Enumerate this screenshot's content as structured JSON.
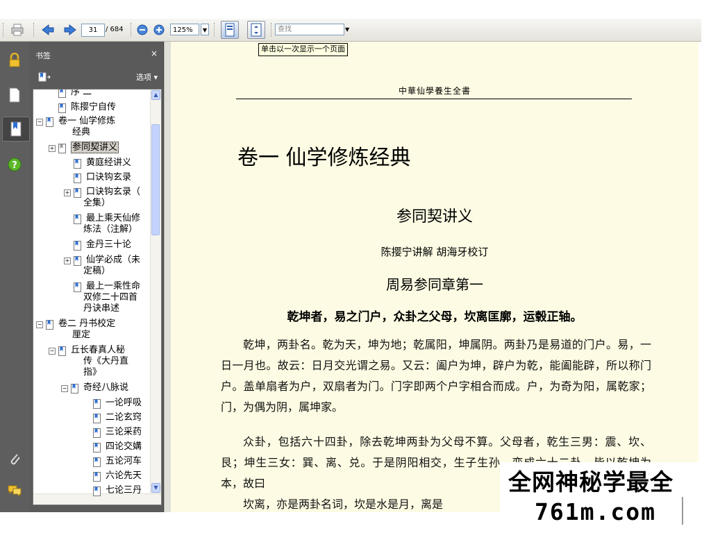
{
  "toolbar": {
    "current_page": "31",
    "total_pages": "/ 684",
    "zoom": "125%",
    "find_placeholder": "查找",
    "tooltip": "单击以一次显示一个页面"
  },
  "bookmarks": {
    "panel_title": "书签",
    "close": "×",
    "options": "选项 ▾",
    "items": [
      {
        "label": "序 二"
      },
      {
        "label": "陈撄宁自传"
      },
      {
        "label": "卷一 仙学修炼"
      },
      {
        "label": "经典"
      },
      {
        "label": "参同契讲义"
      },
      {
        "label": "黄庭经讲义"
      },
      {
        "label": "口诀钩玄录"
      },
      {
        "label": "口诀钩玄录（"
      },
      {
        "label": "全集）"
      },
      {
        "label": "最上乘天仙修"
      },
      {
        "label": "炼法（注解）"
      },
      {
        "label": "金丹三十论"
      },
      {
        "label": "仙学必成（未"
      },
      {
        "label": "定稿）"
      },
      {
        "label": "最上一乘性命"
      },
      {
        "label": "双修二十四首"
      },
      {
        "label": "丹诀串述"
      },
      {
        "label": "卷二 丹书校定"
      },
      {
        "label": "厘定"
      },
      {
        "label": "丘长春真人秘"
      },
      {
        "label": "传《大丹直"
      },
      {
        "label": "指》"
      },
      {
        "label": "奇经八脉说"
      },
      {
        "label": "一论呼吸"
      },
      {
        "label": "二论玄窍"
      },
      {
        "label": "三论采药"
      },
      {
        "label": "四论交媾"
      },
      {
        "label": "五论河车"
      },
      {
        "label": "六论先天"
      },
      {
        "label": "七论三丹"
      }
    ]
  },
  "document": {
    "running_header": "中華仙學養生全書",
    "volume_title": "卷一  仙学修炼经典",
    "chapter_title": "参同契讲义",
    "author_line": "陈撄宁讲解  胡海牙校订",
    "section_title": "周易参同章第一",
    "key_line": "乾坤者，易之门户，众卦之父母，坎离匡廓，运毂正轴。",
    "paragraphs": [
      "乾坤，两卦名。乾为天，坤为地；乾属阳，坤属阴。两卦乃是易道的门户。易，一日一月也。故云：日月交光谓之易。又云：阖户为坤，辟户为乾，能阖能辟，所以称门户。盖单扇者为户，双扇者为门。门字即两个户字相合而成。户，为奇为阳，属乾家；门，为偶为阴，属坤家。",
      "众卦，包括六十四卦，除去乾坤两卦为父母不算。父母者，乾生三男：震、坎、艮；坤生三女：巽、离、兑。于是阴阳相交，生子生孙，变成六十二卦，皆以乾坤为本，故曰",
      "坎离，亦是两卦名词，坎是水是月，离是"
    ]
  },
  "watermark": {
    "line1": "全网神秘学最全",
    "line2": "761m.com"
  }
}
